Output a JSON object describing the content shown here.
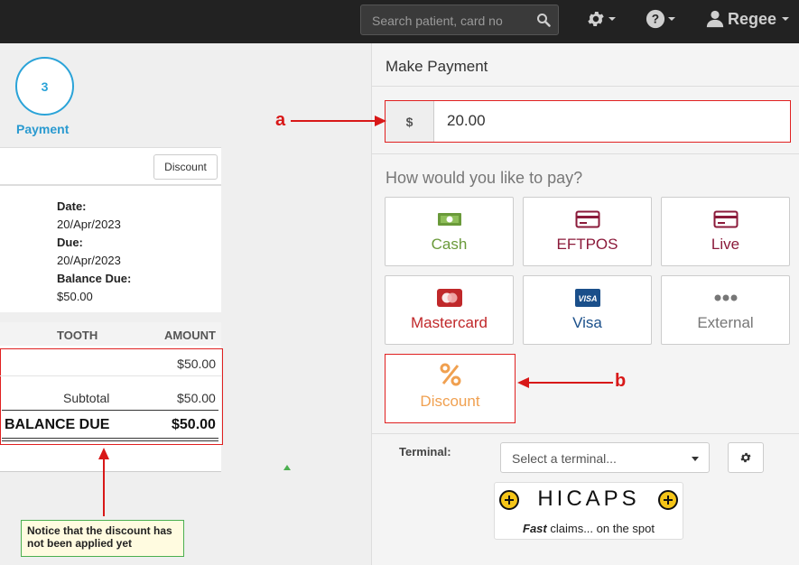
{
  "topbar": {
    "search_placeholder": "Search patient, card no",
    "user_name": "Regee"
  },
  "left": {
    "step_number": "3",
    "step_label": "Payment",
    "discount_button": "Discount",
    "date_label": "Date:",
    "date_value": "20/Apr/2023",
    "due_label": "Due:",
    "due_value": "20/Apr/2023",
    "balance_due_label": "Balance Due:",
    "balance_due_value": "$50.00",
    "table_headers": {
      "tooth": "TOOTH",
      "amount": "AMOUNT"
    },
    "line_amount": "$50.00",
    "subtotal_label": "Subtotal",
    "subtotal_value": "$50.00",
    "balance_due_row_label": "BALANCE DUE",
    "balance_due_row_value": "$50.00",
    "note_text": "Notice that the discount has not been applied yet"
  },
  "payment": {
    "title": "Make Payment",
    "currency_symbol": "$",
    "amount": "20.00",
    "question": "How would you like to pay?",
    "methods": [
      {
        "label": "Cash",
        "color": "#6a9a3a"
      },
      {
        "label": "EFTPOS",
        "color": "#8b1a3a"
      },
      {
        "label": "Live",
        "color": "#8b1a3a"
      },
      {
        "label": "Mastercard",
        "color": "#c0282a"
      },
      {
        "label": "Visa",
        "color": "#1a4f8a"
      },
      {
        "label": "External",
        "color": "#777777"
      }
    ],
    "discount": {
      "label": "Discount",
      "color": "#f0a050"
    },
    "terminal_label": "Terminal:",
    "terminal_placeholder": "Select a terminal...",
    "hicaps_title": "HICAPS",
    "hicaps_tag_bold": "Fast",
    "hicaps_tag_rest": " claims... on the spot"
  },
  "annotations": {
    "a": "a",
    "b": "b"
  },
  "colors": {
    "accent": "#2aa3d8",
    "annotation_red": "#d81818",
    "note_green": "#4caf50"
  }
}
